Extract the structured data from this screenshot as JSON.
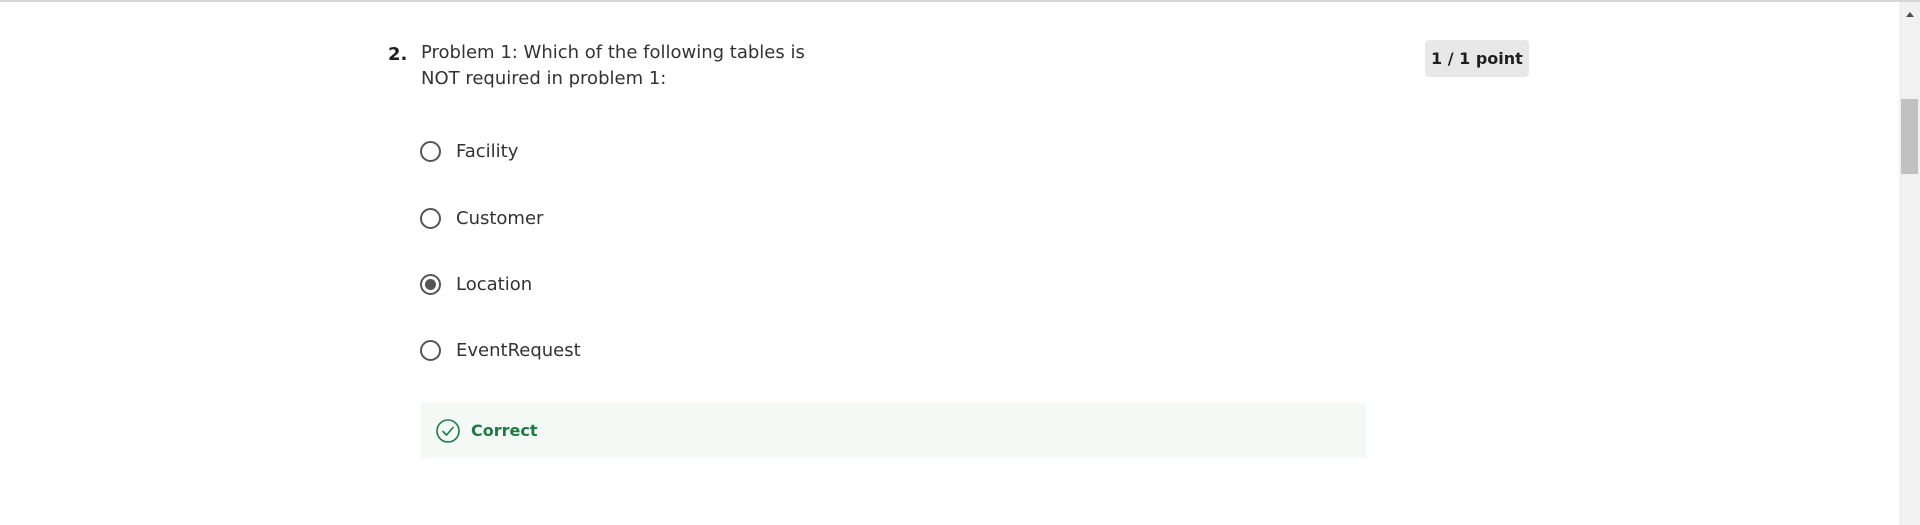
{
  "question": {
    "number": "2.",
    "text_line1": "Problem 1: Which of the following tables is",
    "text_line2": "NOT required in problem 1:",
    "points": "1 / 1 point"
  },
  "options": [
    {
      "label": "Facility",
      "selected": false
    },
    {
      "label": "Customer",
      "selected": false
    },
    {
      "label": "Location",
      "selected": true
    },
    {
      "label": "EventRequest",
      "selected": false
    }
  ],
  "feedback": {
    "label": "Correct",
    "icon": "check-circle-icon",
    "color": "#1d7a45"
  },
  "scrollbar": {
    "icon": "scroll-up-arrow-icon"
  }
}
